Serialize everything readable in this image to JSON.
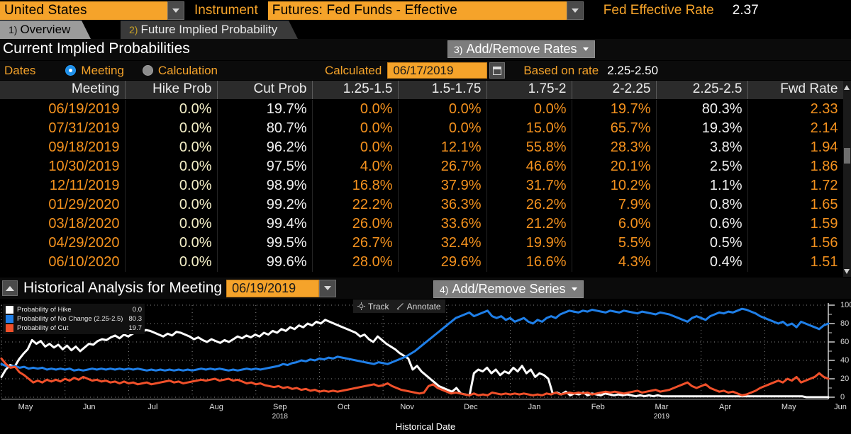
{
  "header": {
    "country": "United States",
    "instrument_label": "Instrument",
    "instrument_value": "Futures: Fed Funds - Effective",
    "rate_label": "Fed Effective Rate",
    "rate_value": "2.37"
  },
  "tabs": [
    {
      "num": "1)",
      "label": "Overview",
      "active": true
    },
    {
      "num": "2)",
      "label": "Future Implied Probability",
      "active": false
    }
  ],
  "section": {
    "title": "Current Implied Probabilities",
    "add_remove_rates": {
      "num": "3)",
      "label": "Add/Remove Rates"
    }
  },
  "controls": {
    "dates_label": "Dates",
    "meeting_label": "Meeting",
    "calculation_label": "Calculation",
    "selected_mode": "Meeting",
    "calculated_label": "Calculated",
    "calculated_date": "06/17/2019",
    "based_on_label": "Based on rate",
    "based_on_value": "2.25-2.50"
  },
  "table": {
    "columns": [
      "Meeting",
      "Hike Prob",
      "Cut Prob",
      "1.25-1.5",
      "1.5-1.75",
      "1.75-2",
      "2-2.25",
      "2.25-2.5",
      "Fwd Rate"
    ],
    "current_rate_column": "2.25-2.5",
    "rows": [
      {
        "meeting": "06/19/2019",
        "hike": "0.0%",
        "cut": "19.7%",
        "r125_15": "0.0%",
        "r15_175": "0.0%",
        "r175_2": "0.0%",
        "r2_225": "19.7%",
        "r225_25": "80.3%",
        "fwd": "2.33"
      },
      {
        "meeting": "07/31/2019",
        "hike": "0.0%",
        "cut": "80.7%",
        "r125_15": "0.0%",
        "r15_175": "0.0%",
        "r175_2": "15.0%",
        "r2_225": "65.7%",
        "r225_25": "19.3%",
        "fwd": "2.14"
      },
      {
        "meeting": "09/18/2019",
        "hike": "0.0%",
        "cut": "96.2%",
        "r125_15": "0.0%",
        "r15_175": "12.1%",
        "r175_2": "55.8%",
        "r2_225": "28.3%",
        "r225_25": "3.8%",
        "fwd": "1.94"
      },
      {
        "meeting": "10/30/2019",
        "hike": "0.0%",
        "cut": "97.5%",
        "r125_15": "4.0%",
        "r15_175": "26.7%",
        "r175_2": "46.6%",
        "r2_225": "20.1%",
        "r225_25": "2.5%",
        "fwd": "1.86"
      },
      {
        "meeting": "12/11/2019",
        "hike": "0.0%",
        "cut": "98.9%",
        "r125_15": "16.8%",
        "r15_175": "37.9%",
        "r175_2": "31.7%",
        "r2_225": "10.2%",
        "r225_25": "1.1%",
        "fwd": "1.72"
      },
      {
        "meeting": "01/29/2020",
        "hike": "0.0%",
        "cut": "99.2%",
        "r125_15": "22.2%",
        "r15_175": "36.3%",
        "r175_2": "26.2%",
        "r2_225": "7.9%",
        "r225_25": "0.8%",
        "fwd": "1.65"
      },
      {
        "meeting": "03/18/2020",
        "hike": "0.0%",
        "cut": "99.4%",
        "r125_15": "26.0%",
        "r15_175": "33.6%",
        "r175_2": "21.2%",
        "r2_225": "6.0%",
        "r225_25": "0.6%",
        "fwd": "1.59"
      },
      {
        "meeting": "04/29/2020",
        "hike": "0.0%",
        "cut": "99.5%",
        "r125_15": "26.7%",
        "r15_175": "32.4%",
        "r175_2": "19.9%",
        "r2_225": "5.5%",
        "r225_25": "0.5%",
        "fwd": "1.56"
      },
      {
        "meeting": "06/10/2020",
        "hike": "0.0%",
        "cut": "99.6%",
        "r125_15": "28.0%",
        "r15_175": "29.6%",
        "r175_2": "16.6%",
        "r2_225": "4.3%",
        "r225_25": "0.4%",
        "fwd": "1.51"
      }
    ]
  },
  "historical": {
    "title": "Historical Analysis for Meeting",
    "meeting_date": "06/19/2019",
    "add_remove_series": {
      "num": "4)",
      "label": "Add/Remove Series"
    },
    "track_label": "Track",
    "annotate_label": "Annotate"
  },
  "chart_data": {
    "type": "line",
    "title": "",
    "xlabel": "Historical Date",
    "ylabel": "",
    "ylim": [
      0,
      100
    ],
    "yticks": [
      0,
      20,
      40,
      60,
      80,
      100
    ],
    "grid": true,
    "legend_position": "top-left",
    "xtick_labels": [
      "May",
      "Jun",
      "Jul",
      "Aug",
      "Sep",
      "Oct",
      "Nov",
      "Dec",
      "Jan",
      "Feb",
      "Mar",
      "Apr",
      "May",
      "Jun"
    ],
    "xtick_years": {
      "Sep": "2018",
      "Mar": "2019"
    },
    "series": [
      {
        "name": "Probability of Hike",
        "color": "#ffffff",
        "last_value": "0.0",
        "values": [
          22,
          30,
          35,
          33,
          41,
          47,
          52,
          62,
          58,
          61,
          55,
          58,
          54,
          57,
          52,
          56,
          51,
          55,
          50,
          54,
          58,
          57,
          61,
          63,
          62,
          65,
          67,
          64,
          68,
          66,
          69,
          71,
          70,
          73,
          72,
          70,
          68,
          66,
          69,
          67,
          71,
          70,
          68,
          66,
          63,
          65,
          62,
          60,
          63,
          61,
          59,
          62,
          60,
          63,
          66,
          64,
          67,
          65,
          68,
          66,
          70,
          68,
          72,
          70,
          74,
          72,
          76,
          74,
          78,
          76,
          80,
          78,
          82,
          80,
          84,
          82,
          80,
          78,
          76,
          74,
          72,
          70,
          66,
          68,
          63,
          60,
          66,
          62,
          58,
          55,
          52,
          48,
          45,
          42,
          30,
          34,
          28,
          24,
          20,
          16,
          12,
          10,
          8,
          6,
          10,
          4,
          3,
          2,
          26,
          30,
          28,
          32,
          26,
          30,
          24,
          28,
          26,
          32,
          28,
          34,
          26,
          30,
          22,
          26,
          24,
          20,
          4,
          5,
          3,
          6,
          2,
          4,
          3,
          5,
          2,
          4,
          3,
          2,
          4,
          3,
          2,
          3,
          2,
          3,
          2,
          1,
          2,
          1,
          2,
          1,
          2,
          1,
          1,
          1,
          1,
          1,
          1,
          1,
          1,
          1,
          1,
          1,
          1,
          1,
          1,
          1,
          1,
          1,
          1,
          1,
          1,
          1,
          1,
          1,
          1,
          1,
          1,
          1,
          1,
          1,
          1,
          1,
          1,
          1,
          0,
          0,
          0,
          0,
          0,
          0
        ]
      },
      {
        "name": "Probability of No Change (2.25-2.5)",
        "color": "#1f7fe8",
        "last_value": "80.3",
        "values": [
          36,
          34,
          33,
          34,
          32,
          33,
          31,
          32,
          31,
          32,
          30,
          31,
          30,
          31,
          30,
          31,
          29,
          30,
          29,
          30,
          31,
          30,
          31,
          30,
          31,
          30,
          31,
          30,
          31,
          30,
          31,
          30,
          29,
          30,
          29,
          30,
          29,
          30,
          29,
          30,
          29,
          30,
          29,
          30,
          31,
          30,
          31,
          30,
          31,
          30,
          29,
          30,
          29,
          30,
          31,
          30,
          31,
          30,
          31,
          32,
          33,
          34,
          36,
          35,
          37,
          38,
          40,
          39,
          41,
          40,
          42,
          41,
          43,
          42,
          44,
          43,
          42,
          41,
          40,
          39,
          38,
          37,
          36,
          38,
          37,
          36,
          38,
          40,
          42,
          44,
          47,
          50,
          54,
          58,
          62,
          66,
          70,
          74,
          78,
          82,
          86,
          88,
          90,
          92,
          88,
          90,
          92,
          94,
          88,
          86,
          88,
          84,
          86,
          82,
          84,
          86,
          82,
          80,
          84,
          82,
          86,
          88,
          86,
          90,
          92,
          94,
          93,
          92,
          94,
          93,
          95,
          94,
          93,
          92,
          94,
          93,
          92,
          94,
          93,
          92,
          91,
          93,
          92,
          91,
          90,
          92,
          91,
          90,
          88,
          86,
          84,
          82,
          86,
          88,
          86,
          84,
          88,
          90,
          92,
          91,
          93,
          92,
          94,
          96,
          95,
          93,
          91,
          88,
          86,
          84,
          82,
          80,
          82,
          78,
          80,
          76,
          82,
          80,
          78,
          76,
          74,
          78,
          80
        ]
      },
      {
        "name": "Probability of Cut",
        "color": "#f0502a",
        "last_value": "19.7",
        "values": [
          42,
          36,
          32,
          33,
          27,
          24,
          20,
          16,
          18,
          16,
          19,
          17,
          19,
          17,
          20,
          18,
          21,
          19,
          22,
          20,
          18,
          19,
          17,
          18,
          16,
          17,
          15,
          17,
          15,
          16,
          14,
          15,
          16,
          14,
          15,
          16,
          17,
          18,
          16,
          17,
          15,
          16,
          17,
          18,
          19,
          18,
          19,
          20,
          18,
          19,
          20,
          18,
          19,
          17,
          15,
          16,
          14,
          15,
          13,
          12,
          11,
          12,
          10,
          11,
          9,
          10,
          8,
          9,
          7,
          8,
          6,
          7,
          6,
          7,
          6,
          7,
          8,
          9,
          10,
          11,
          12,
          13,
          14,
          12,
          13,
          15,
          12,
          10,
          8,
          7,
          6,
          5,
          4,
          5,
          12,
          14,
          10,
          8,
          6,
          4,
          5,
          4,
          3,
          2,
          4,
          2,
          3,
          2,
          5,
          4,
          3,
          4,
          3,
          4,
          3,
          4,
          3,
          2,
          3,
          2,
          4,
          3,
          5,
          3,
          4,
          5,
          4,
          5,
          4,
          5,
          3,
          4,
          5,
          6,
          5,
          6,
          5,
          4,
          5,
          6,
          7,
          5,
          6,
          7,
          8,
          6,
          7,
          8,
          10,
          12,
          14,
          16,
          12,
          10,
          12,
          14,
          10,
          8,
          6,
          7,
          5,
          6,
          4,
          2,
          3,
          5,
          7,
          10,
          12,
          14,
          16,
          18,
          16,
          20,
          18,
          22,
          16,
          18,
          20,
          22,
          26,
          22,
          20
        ]
      }
    ]
  }
}
